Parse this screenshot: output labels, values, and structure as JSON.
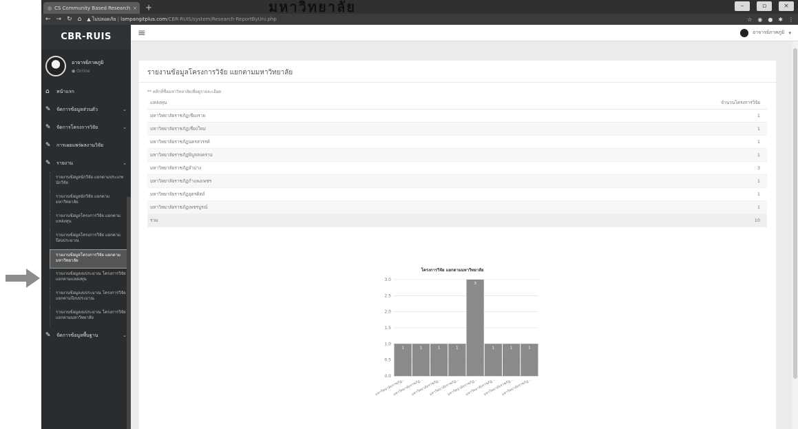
{
  "browser": {
    "tab_title": "CS Community Based Research",
    "security_label": "ไม่ปลอดภัย",
    "url_host": "lampangitplus.com",
    "url_path": "/CBR-RUIS/system/Research-ReportByUni.php",
    "watermark": "มหาวิทยาลัย"
  },
  "app": {
    "brand": "CBR-RUIS",
    "user_name": "อาจารย์ภาคภูมิ",
    "user_status": "Online"
  },
  "sidebar": {
    "items": [
      {
        "label": "หน้าแรก",
        "icon": "home-icon",
        "glyph": "⌂"
      },
      {
        "label": "จัดการข้อมูลส่วนตัว",
        "icon": "edit-icon",
        "glyph": "✎",
        "chevron": true
      },
      {
        "label": "จัดการโครงการวิจัย",
        "icon": "edit-icon",
        "glyph": "✎",
        "chevron": true
      },
      {
        "label": "การเผยแพร่ผลงานวิจัย",
        "icon": "edit-icon",
        "glyph": "✎"
      },
      {
        "label": "รายงาน",
        "icon": "edit-icon",
        "glyph": "✎",
        "chevron": true
      }
    ],
    "subitems": [
      {
        "label": "รายงานข้อมูลนักวิจัย แยกตามประเภทนักวิจัย"
      },
      {
        "label": "รายงานข้อมูลนักวิจัย แยกตามมหาวิทยาลัย"
      },
      {
        "label": "รายงานข้อมูลโครงการวิจัย แยกตามแหล่งทุน"
      },
      {
        "label": "รายงานข้อมูลโครงการวิจัย แยกตามปีงบประมาณ"
      },
      {
        "label": "รายงานข้อมูลโครงการวิจัย แยกตามมหาวิทยาลัย",
        "active": true
      },
      {
        "label": "รายงานข้อมูลงบประมาณ โครงการวิจัย แยกตามแหล่งทุน"
      },
      {
        "label": "รายงานข้อมูลงบประมาณ โครงการวิจัย แยกตามปีงบประมาณ"
      },
      {
        "label": "รายงานข้อมูลงบประมาณ โครงการวิจัย แยกตามมหาวิทยาลัย"
      }
    ],
    "last_item": {
      "label": "จัดการข้อมูลพื้นฐาน",
      "icon": "edit-icon",
      "glyph": "✎"
    }
  },
  "topbar": {
    "user": "อาจารย์ภาคภูมิ"
  },
  "panel": {
    "title": "รายงานข้อมูลโครงการวิจัย แยกตามมหาวิทยาลัย",
    "note": "** คลิกที่ชื่อมหาวิทยาลัยเพื่อดูรายละเอียด",
    "col_name": "แหล่งทุน",
    "col_count": "จำนวนโครงการวิจัย",
    "rows": [
      {
        "name": "มหาวิทยาลัยราชภัฏเชียงราย",
        "count": "1"
      },
      {
        "name": "มหาวิทยาลัยราชภัฏเชียงใหม่",
        "count": "1"
      },
      {
        "name": "มหาวิทยาลัยราชภัฏนครสวรรค์",
        "count": "1"
      },
      {
        "name": "มหาวิทยาลัยราชภัฏพิบูลสงคราม",
        "count": "1"
      },
      {
        "name": "มหาวิทยาลัยราชภัฏลำปาง",
        "count": "3"
      },
      {
        "name": "มหาวิทยาลัยราชภัฏกำแพงเพชร",
        "count": "1"
      },
      {
        "name": "มหาวิทยาลัยราชภัฏอุตรดิตถ์",
        "count": "1"
      },
      {
        "name": "มหาวิทยาลัยราชภัฏเพชรบูรณ์",
        "count": "1"
      }
    ],
    "total_label": "รวม",
    "total_value": "10"
  },
  "chart_data": {
    "type": "bar",
    "title": "โครงการวิจัย แยกตามมหาวิทยาลัย",
    "categories": [
      "มหาวิทยาลัยราชภัฏ...",
      "มหาวิทยาลัยราชภัฏ...",
      "มหาวิทยาลัยราชภัฏ...",
      "มหาวิทยาลัยราชภัฏ...",
      "มหาวิทยาลัยราชภัฏ...",
      "มหาวิทยาลัยราชภัฏ...",
      "มหาวิทยาลัยราชภัฏ...",
      "มหาวิทยาลัยราชภัฏ..."
    ],
    "values": [
      1,
      1,
      1,
      1,
      3,
      1,
      1,
      1
    ],
    "ylim": [
      0,
      3
    ],
    "yticks": [
      "0.0",
      "0.5",
      "1.0",
      "1.5",
      "2.0",
      "2.5",
      "3.0"
    ],
    "bar_color": "#8a8a8a",
    "grid": true
  }
}
